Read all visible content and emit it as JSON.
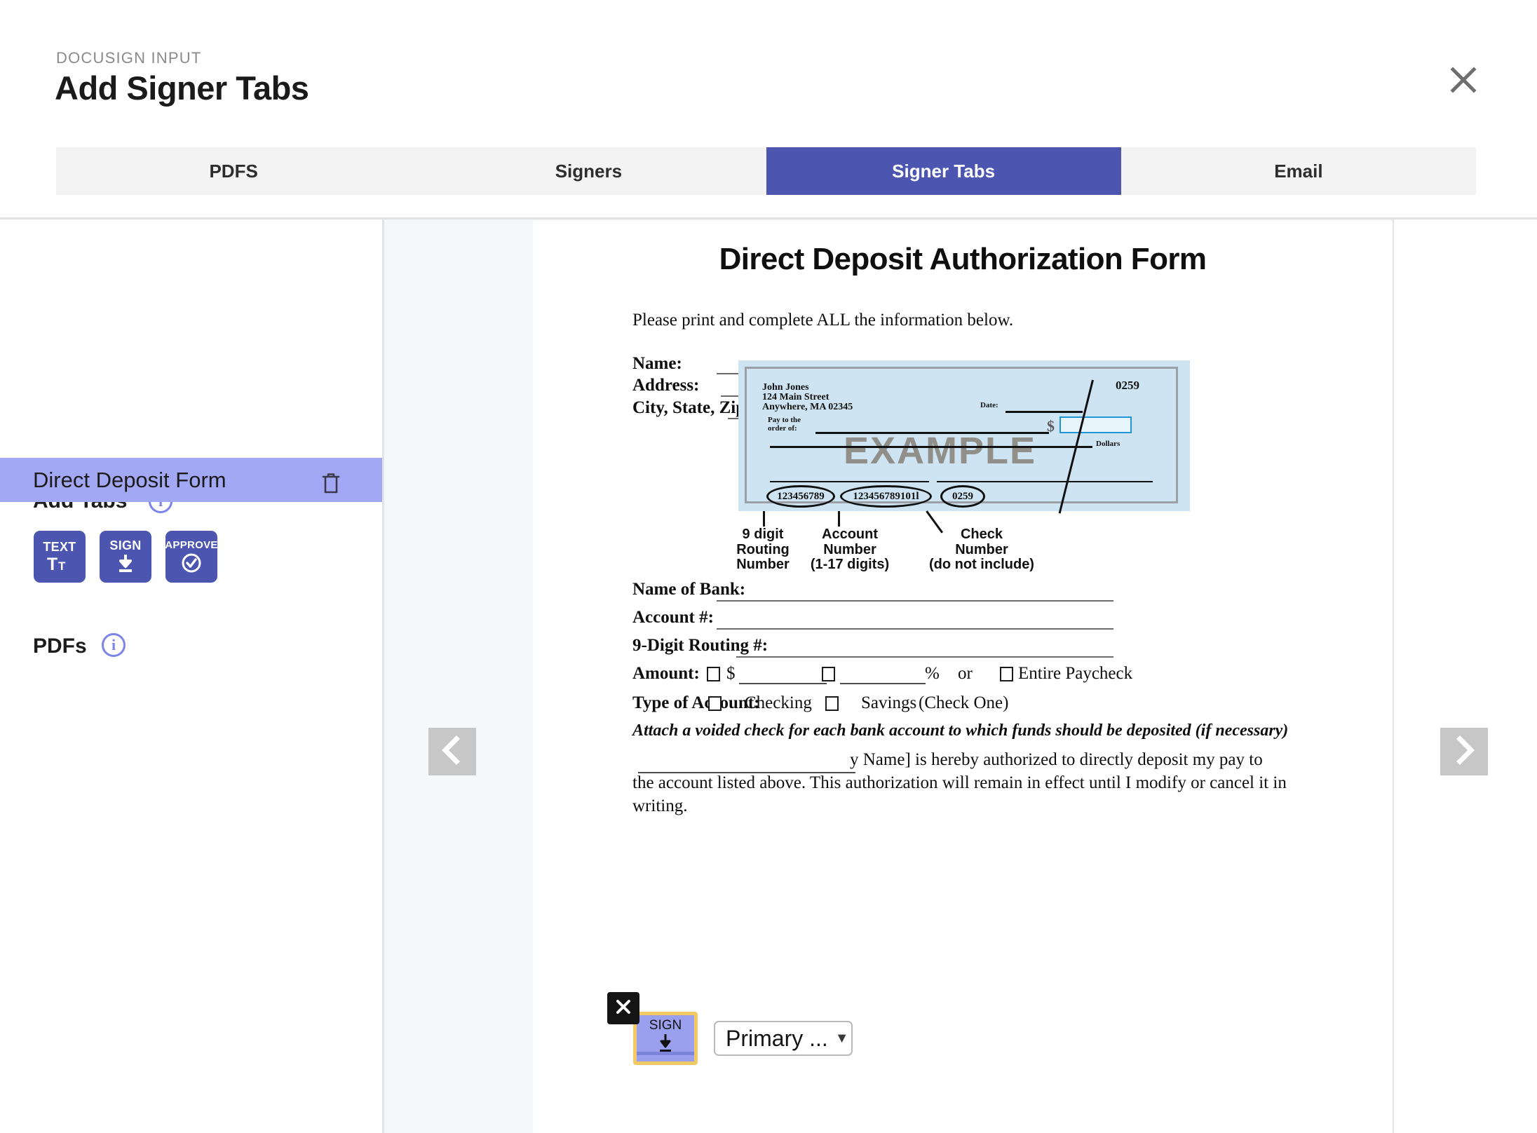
{
  "header": {
    "eyebrow": "DOCUSIGN INPUT",
    "title": "Add Signer Tabs",
    "close_icon": "close-icon"
  },
  "tabs": [
    {
      "label": "PDFS",
      "active": false
    },
    {
      "label": "Signers",
      "active": false
    },
    {
      "label": "Signer Tabs",
      "active": true
    },
    {
      "label": "Email",
      "active": false
    }
  ],
  "sidebar": {
    "add_tabs_heading": "Add Tabs",
    "add_tabs_info_icon": "info-icon",
    "tab_buttons": [
      {
        "caption": "TEXT",
        "glyph": "Tt",
        "icon": "text-tab-icon"
      },
      {
        "caption": "SIGN",
        "glyph": "download-arrow",
        "icon": "sign-tab-icon"
      },
      {
        "caption": "APPROVE",
        "glyph": "check-circle",
        "icon": "approve-tab-icon"
      }
    ],
    "pdfs_heading": "PDFs",
    "pdfs_info_icon": "info-icon",
    "pdf_items": [
      {
        "name": "Direct Deposit Form",
        "delete_icon": "trash-icon",
        "selected": true
      }
    ]
  },
  "viewer": {
    "prev_label": "‹",
    "next_label": "›",
    "prev_icon": "chevron-left-icon",
    "next_icon": "chevron-right-icon"
  },
  "document": {
    "title": "Direct Deposit Authorization Form",
    "subtitle": "Please print and complete ALL the information below.",
    "fields_top": [
      {
        "label": "Name:"
      },
      {
        "label": "Address:"
      },
      {
        "label": "City, State, Zip:"
      }
    ],
    "check_sample": {
      "payer_name": "John Jones",
      "payer_street": "124 Main Street",
      "payer_city": "Anywhere, MA 02345",
      "check_no_top": "0259",
      "date_label": "Date:",
      "pay_to_line1": "Pay to the",
      "pay_to_line2": "order of:",
      "dollar_sign": "$",
      "dollars_label": "Dollars",
      "watermark": "EXAMPLE",
      "micr_routing": "123456789",
      "micr_account": "123456789101l",
      "micr_check": "0259",
      "callouts": [
        "9 digit\nRouting\nNumber",
        "Account\nNumber\n(1-17 digits)",
        "Check\nNumber\n(do not include)"
      ]
    },
    "fields_bottom": [
      {
        "label": "Name of Bank:"
      },
      {
        "label": "Account #:"
      },
      {
        "label": "9-Digit Routing #:"
      }
    ],
    "amount_row": {
      "label": "Amount:",
      "dollar": "$",
      "percent": "%",
      "or": "or",
      "entire": "Entire Paycheck"
    },
    "account_type_row": {
      "label": "Type of Account:",
      "checking": "Checking",
      "savings": "Savings",
      "hint": "(Check One)"
    },
    "note_italic": "Attach a voided check for each bank account to which funds should be deposited (if necessary)",
    "body_line_1": "y Name] is hereby authorized to directly deposit my pay to",
    "body_line_2": "the account listed above. This authorization will remain in effect until I modify or cancel it in",
    "body_line_3": "writing."
  },
  "overlay": {
    "close_icon": "close-icon",
    "sign_tab_caption": "SIGN",
    "sign_tab_icon": "download-arrow-icon",
    "signer_select_value": "Primary ...",
    "signer_select_caret": "▼"
  },
  "colors": {
    "accent": "#4c56b0",
    "tab_strip_bg": "#f3f3f4",
    "selected_pdf": "#a3a8f5",
    "overlay_highlight": "#f2c963",
    "overlay_tab": "#9aa0ee",
    "viewer_bg": "#f6f7f9"
  }
}
